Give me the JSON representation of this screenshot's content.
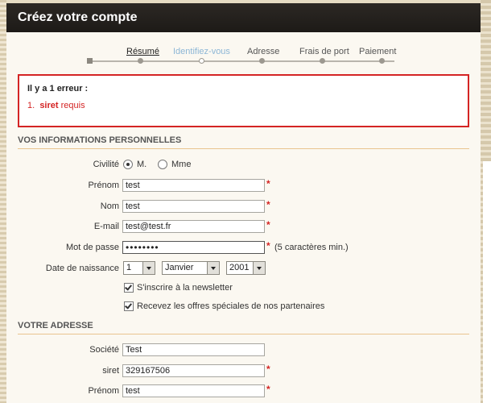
{
  "header": {
    "title": "Créez votre compte"
  },
  "steps": [
    {
      "label": "Résumé",
      "state": "done"
    },
    {
      "label": "Identifiez-vous",
      "state": "active"
    },
    {
      "label": "Adresse",
      "state": "pending"
    },
    {
      "label": "Frais de port",
      "state": "pending"
    },
    {
      "label": "Paiement",
      "state": "pending"
    }
  ],
  "error": {
    "title": "Il y a 1 erreur :",
    "number": "1.",
    "field": "siret",
    "message": "requis"
  },
  "personal": {
    "section_title": "VOS INFORMATIONS PERSONNELLES",
    "civility_label": "Civilité",
    "civility_options": [
      "M.",
      "Mme"
    ],
    "civility_selected": "M.",
    "firstname_label": "Prénom",
    "firstname_value": "test",
    "lastname_label": "Nom",
    "lastname_value": "test",
    "email_label": "E-mail",
    "email_value": "test@test.fr",
    "password_label": "Mot de passe",
    "password_value": "••••••••",
    "password_hint": "(5 caractères min.)",
    "birth_label": "Date de naissance",
    "birth_day": "1",
    "birth_month": "Janvier",
    "birth_year": "2001",
    "newsletter_label": "S'inscrire à la newsletter",
    "newsletter_checked": true,
    "offers_label": "Recevez les offres spéciales de nos partenaires",
    "offers_checked": true
  },
  "address": {
    "section_title": "VOTRE ADRESSE",
    "company_label": "Société",
    "company_value": "Test",
    "siret_label": "siret",
    "siret_value": "329167506",
    "firstname_label": "Prénom",
    "firstname_value": "test"
  },
  "required_mark": "*",
  "colors": {
    "header_bg": "#1d1a17",
    "error_red": "#d42424",
    "active_step": "#8cb6d6",
    "rule": "#e9c48f"
  }
}
